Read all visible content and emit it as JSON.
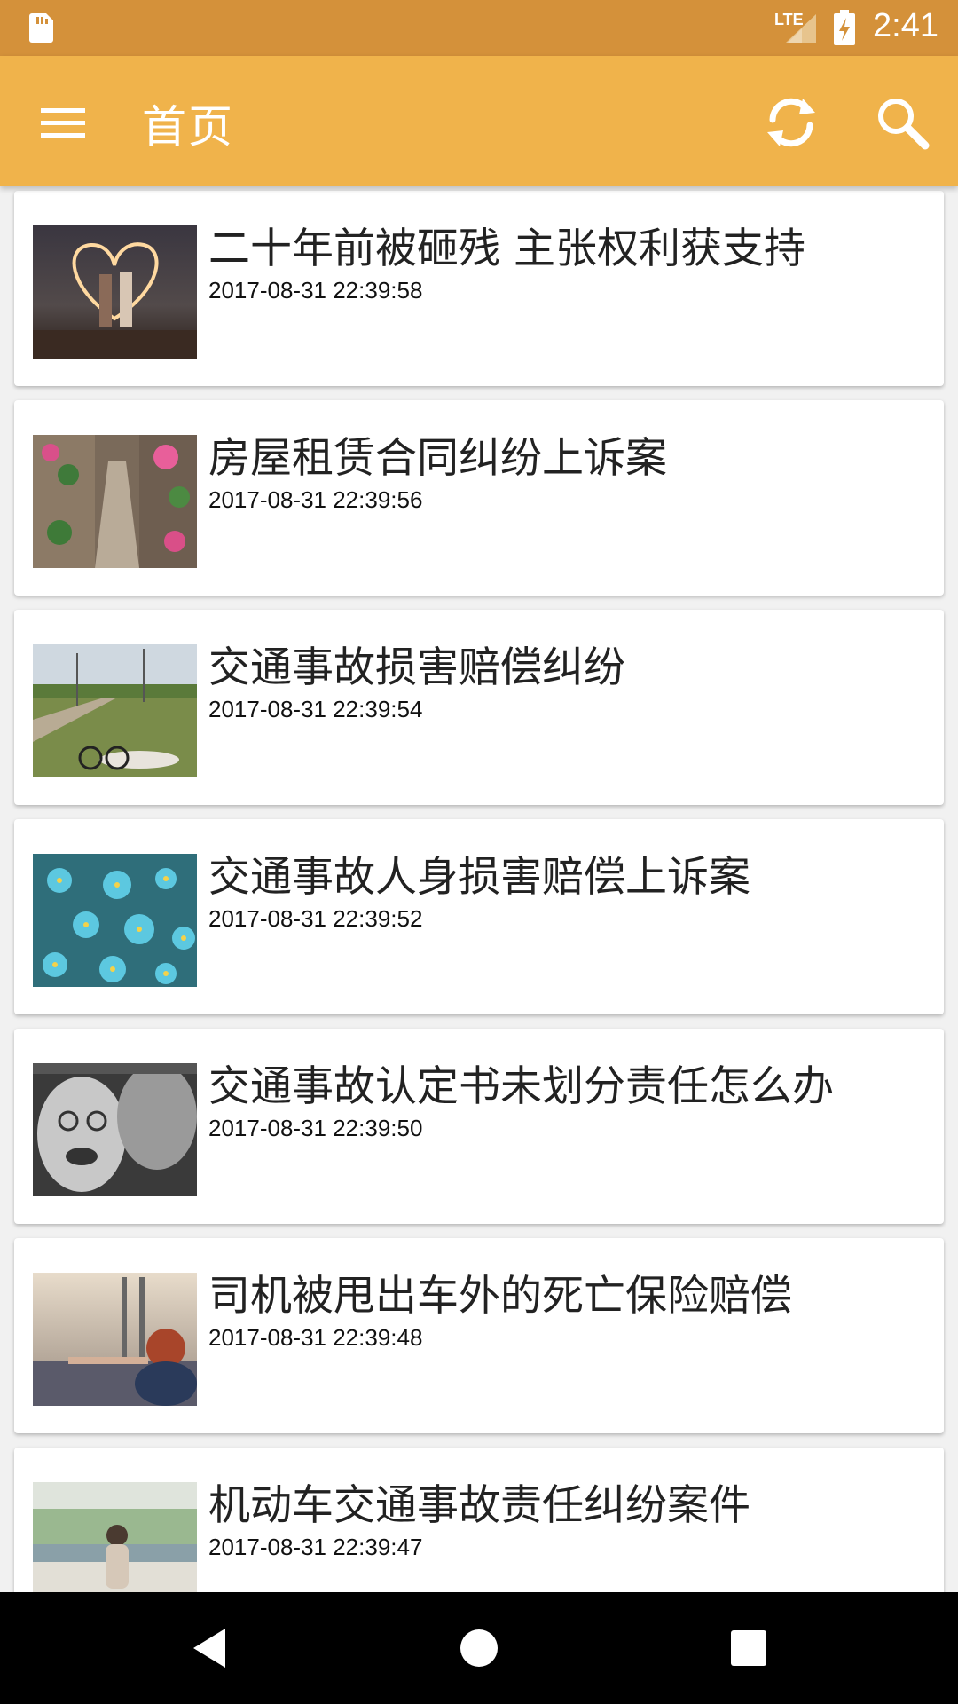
{
  "status_bar": {
    "network_label": "LTE",
    "time": "2:41",
    "icons": [
      "sd-card-icon",
      "signal-icon",
      "battery-charging-icon"
    ]
  },
  "app_bar": {
    "title": "首页",
    "background": "#f0b34b",
    "icons": [
      "menu-icon",
      "refresh-icon",
      "search-icon"
    ]
  },
  "articles": [
    {
      "title": "二十年前被砸残 主张权利获支持",
      "time": "2017-08-31 22:39:58",
      "thumbnail": "sparkler-heart-couple"
    },
    {
      "title": "房屋租赁合同纠纷上诉案",
      "time": "2017-08-31 22:39:56",
      "thumbnail": "flower-alley"
    },
    {
      "title": "交通事故损害赔偿纠纷",
      "time": "2017-08-31 22:39:54",
      "thumbnail": "person-with-bicycle-on-roadside"
    },
    {
      "title": "交通事故人身损害赔偿上诉案",
      "time": "2017-08-31 22:39:52",
      "thumbnail": "blue-flowers"
    },
    {
      "title": "交通事故认定书未划分责任怎么办",
      "time": "2017-08-31 22:39:50",
      "thumbnail": "elderly-couple-kiss"
    },
    {
      "title": "司机被甩出车外的死亡保险赔偿",
      "time": "2017-08-31 22:39:48",
      "thumbnail": "woman-at-car-window"
    },
    {
      "title": "机动车交通事故责任纠纷案件",
      "time": "2017-08-31 22:39:47",
      "thumbnail": "child-by-lake"
    }
  ],
  "nav_bar": {
    "icons": [
      "back-icon",
      "home-icon",
      "recents-icon"
    ]
  }
}
